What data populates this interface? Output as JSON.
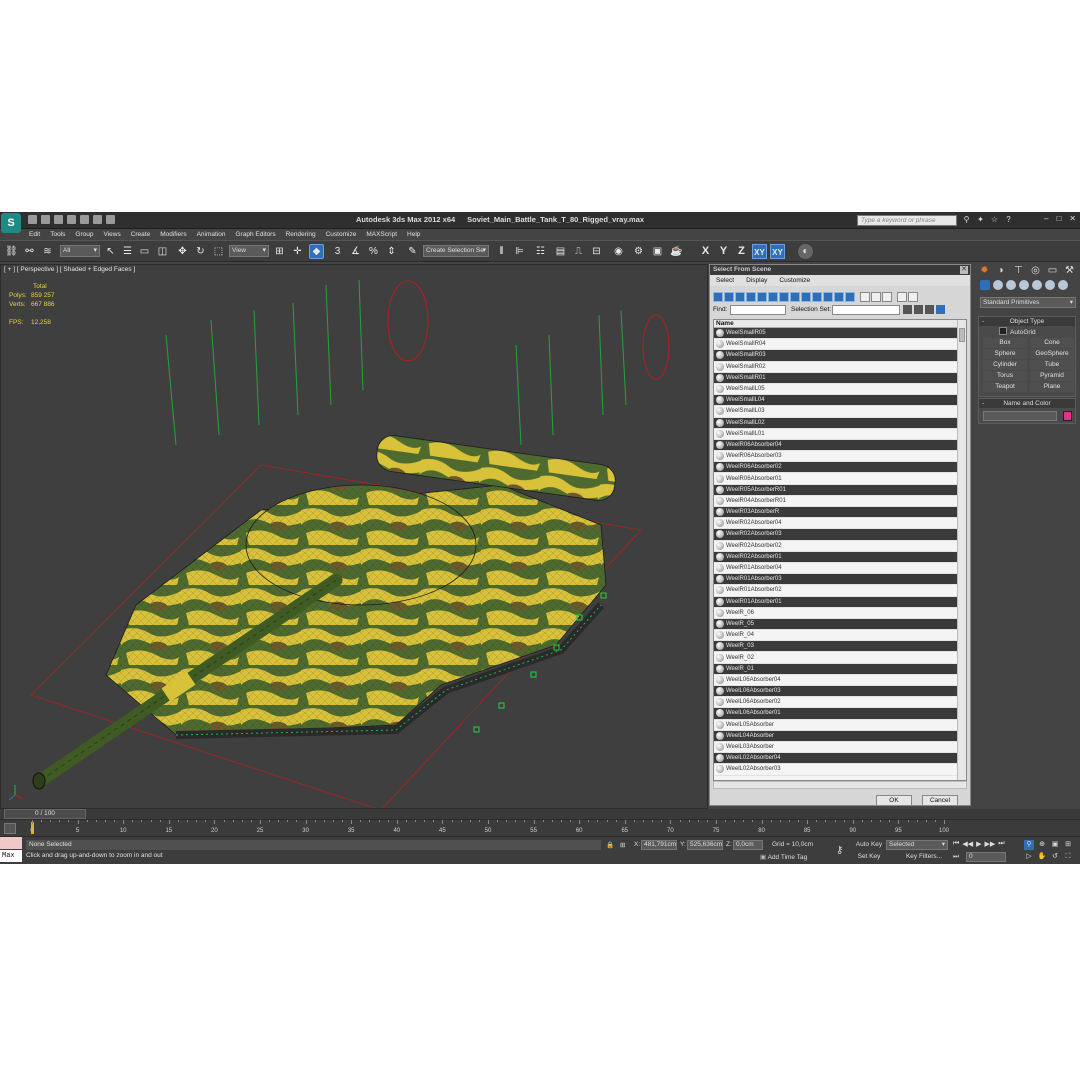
{
  "window": {
    "app_title": "Autodesk 3ds Max  2012 x64",
    "file_name": "Soviet_Main_Battle_Tank_T_80_Rigged_vray.max",
    "search_placeholder": "Type a keyword or phrase",
    "logo_glyph": "S"
  },
  "menu": [
    "Edit",
    "Tools",
    "Group",
    "Views",
    "Create",
    "Modifiers",
    "Animation",
    "Graph Editors",
    "Rendering",
    "Customize",
    "MAXScript",
    "Help"
  ],
  "toolbar": {
    "filter_value": "All",
    "coord_system": "View",
    "selection_set": "Create Selection Se",
    "axis": [
      "X",
      "Y",
      "Z",
      "XY",
      "XY"
    ]
  },
  "viewport": {
    "label": "[ + ] [ Perspective ] [ Shaded + Edged Faces ]",
    "stats_total": "Total",
    "polys_label": "Polys:",
    "polys_value": "859 257",
    "verts_label": "Verts:",
    "verts_value": "667 886",
    "fps_label": "FPS:",
    "fps_value": "12,258",
    "camo_colors": [
      "#d8c23a",
      "#4e6a2e",
      "#6b5a2a"
    ]
  },
  "dialog": {
    "title": "Select From Scene",
    "menu": [
      "Select",
      "Display",
      "Customize"
    ],
    "find_label": "Find:",
    "selection_set_label": "Selection Set:",
    "column_name": "Name",
    "items": [
      "WeelSmallR05",
      "WeelSmallR04",
      "WeelSmallR03",
      "WeelSmallR02",
      "WeelSmallR01",
      "WeelSmallL05",
      "WeelSmallL04",
      "WeelSmallL03",
      "WeelSmallL02",
      "WeelSmallL01",
      "WeelR06Absorber04",
      "WeelR06Absorber03",
      "WeelR06Absorber02",
      "WeelR06Absorber01",
      "WeelR05AbsorberR01",
      "WeelR04AbsorberR01",
      "WeelR03AbsorberR",
      "WeelR02Absorber04",
      "WeelR02Absorber03",
      "WeelR02Absorber02",
      "WeelR02Absorber01",
      "WeelR01Absorber04",
      "WeelR01Absorber03",
      "WeelR01Absorber02",
      "WeelR01Absorber01",
      "WeelR_06",
      "WeelR_05",
      "WeelR_04",
      "WeelR_03",
      "WeelR_02",
      "WeelR_01",
      "WeelL06Absorber04",
      "WeelL06Absorber03",
      "WeelL06Absorber02",
      "WeelL06Absorber01",
      "WeelL05Absorber",
      "WeelL04Absorber",
      "WeelL03Absorber",
      "WeelL02Absorber04",
      "WeelL02Absorber03"
    ],
    "ok_label": "OK",
    "cancel_label": "Cancel"
  },
  "command_panel": {
    "category": "Standard Primitives",
    "object_type_title": "Object Type",
    "autogrid_label": "AutoGrid",
    "primitives": [
      "Box",
      "Cone",
      "Sphere",
      "GeoSphere",
      "Cylinder",
      "Tube",
      "Torus",
      "Pyramid",
      "Teapot",
      "Plane"
    ],
    "name_color_title": "Name and Color",
    "object_color": "#e0308a"
  },
  "timeline": {
    "slider_text": "0 / 100",
    "current_frame": 0,
    "total_frames": 100,
    "tick_labels": [
      "0",
      "5",
      "10",
      "15",
      "20",
      "25",
      "30",
      "35",
      "40",
      "45",
      "50",
      "55",
      "60",
      "65",
      "70",
      "75",
      "80",
      "85",
      "90",
      "95",
      "100"
    ]
  },
  "status": {
    "maxscript_label": "Max",
    "selection_text": "None Selected",
    "prompt_text": "Click and drag up-and-down to zoom in and out",
    "x_label": "X:",
    "x_value": "481,791cm",
    "y_label": "Y:",
    "y_value": "525,636cm",
    "z_label": "Z:",
    "z_value": "0,0cm",
    "grid_text": "Grid = 10,0cm",
    "add_time_tag": "Add Time Tag",
    "auto_key": "Auto Key",
    "set_key": "Set Key",
    "key_mode": "Selected",
    "key_filters": "Key Filters...",
    "frame_value": "0"
  }
}
